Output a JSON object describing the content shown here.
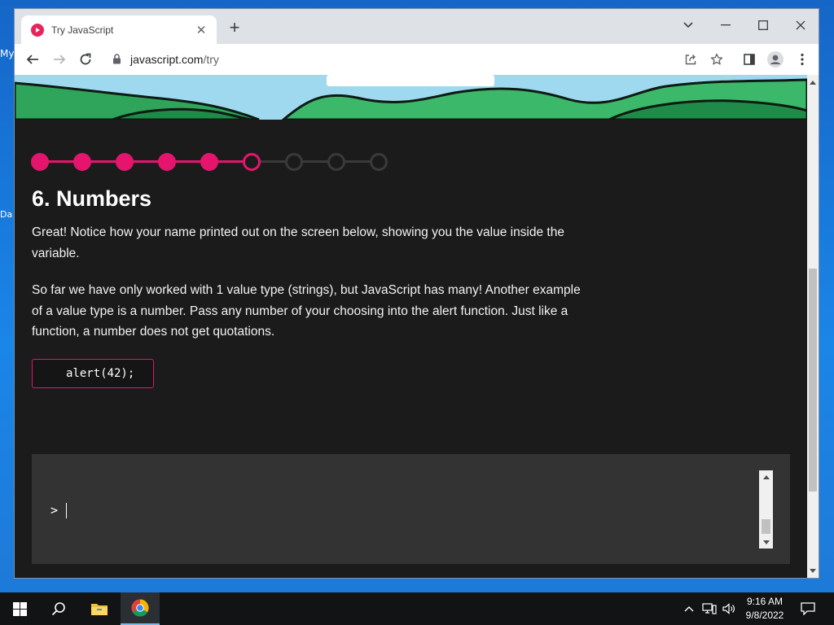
{
  "desktop": {
    "label_my": "My",
    "label_da": "Da"
  },
  "browser": {
    "tab": {
      "title": "Try JavaScript"
    },
    "address": {
      "host": "javascript.com",
      "path": "/try"
    }
  },
  "lesson": {
    "progress": {
      "completed": 5,
      "current": 6,
      "total": 9
    },
    "title": "6. Numbers",
    "paragraph1": "Great! Notice how your name printed out on the screen below, showing you the value inside the variable.",
    "paragraph2": "So far we have only worked with 1 value type (strings), but JavaScript has many! Another example of a value type is a number. Pass any number of your choosing into the alert function. Just like a function, a number does not get quotations.",
    "code_example": "alert(42);"
  },
  "console": {
    "prompt": ">",
    "input_value": ""
  },
  "taskbar": {
    "time": "9:16 AM",
    "date": "9/8/2022"
  },
  "colors": {
    "accent": "#e5156e",
    "page_bg": "#1b1b1b",
    "console_bg": "#333333"
  },
  "icons": [
    "windows-start-icon",
    "search-icon",
    "file-explorer-icon",
    "chrome-icon",
    "chevron-up-icon",
    "network-icon",
    "volume-icon",
    "notification-icon"
  ]
}
